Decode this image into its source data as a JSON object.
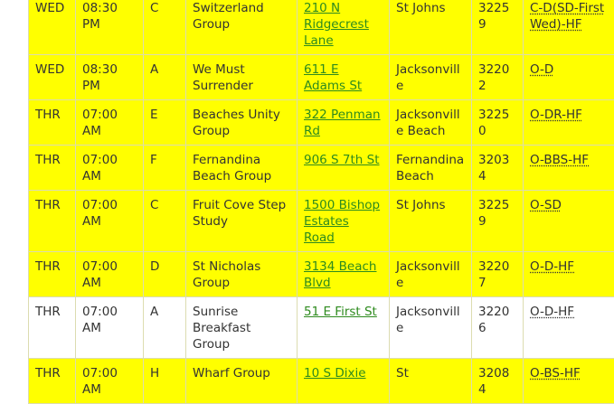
{
  "meetings": [
    {
      "day": "WED",
      "time": "08:30 PM",
      "type": "C",
      "name": "Switzerland Group",
      "address": "210 N Ridgecrest Lane",
      "city": "St Johns",
      "zip": "32259",
      "codes": "C-D(SD-First Wed)-HF",
      "highlight": true
    },
    {
      "day": "WED",
      "time": "08:30 PM",
      "type": "A",
      "name": "We Must Surrender",
      "address": "611 E Adams St",
      "city": "Jacksonville",
      "zip": "32202",
      "codes": "O-D",
      "highlight": true
    },
    {
      "day": "THR",
      "time": "07:00 AM",
      "type": "E",
      "name": "Beaches Unity Group",
      "address": "322 Penman Rd",
      "city": "Jacksonville Beach",
      "zip": "32250",
      "codes": "O-DR-HF",
      "highlight": true
    },
    {
      "day": "THR",
      "time": "07:00 AM",
      "type": "F",
      "name": "Fernandina Beach Group",
      "address": "906 S 7th St",
      "city": "Fernandina Beach",
      "zip": "32034",
      "codes": "O-BBS-HF",
      "highlight": true
    },
    {
      "day": "THR",
      "time": "07:00 AM",
      "type": "C",
      "name": "Fruit Cove Step Study",
      "address": "1500 Bishop Estates Road",
      "city": "St Johns",
      "zip": "32259",
      "codes": "O-SD",
      "highlight": true
    },
    {
      "day": "THR",
      "time": "07:00 AM",
      "type": "D",
      "name": "St Nicholas Group",
      "address": "3134 Beach Blvd",
      "city": "Jacksonville",
      "zip": "32207",
      "codes": "O-D-HF",
      "highlight": true
    },
    {
      "day": "THR",
      "time": "07:00 AM",
      "type": "A",
      "name": "Sunrise Breakfast Group",
      "address": "51 E First St",
      "city": "Jacksonville",
      "zip": "32206",
      "codes": "O-D-HF",
      "highlight": false
    },
    {
      "day": "THR",
      "time": "07:00 AM",
      "type": "H",
      "name": "Wharf Group",
      "address": "10 S Dixie",
      "city": "St",
      "zip": "32084",
      "codes": "O-BS-HF",
      "highlight": true
    }
  ]
}
